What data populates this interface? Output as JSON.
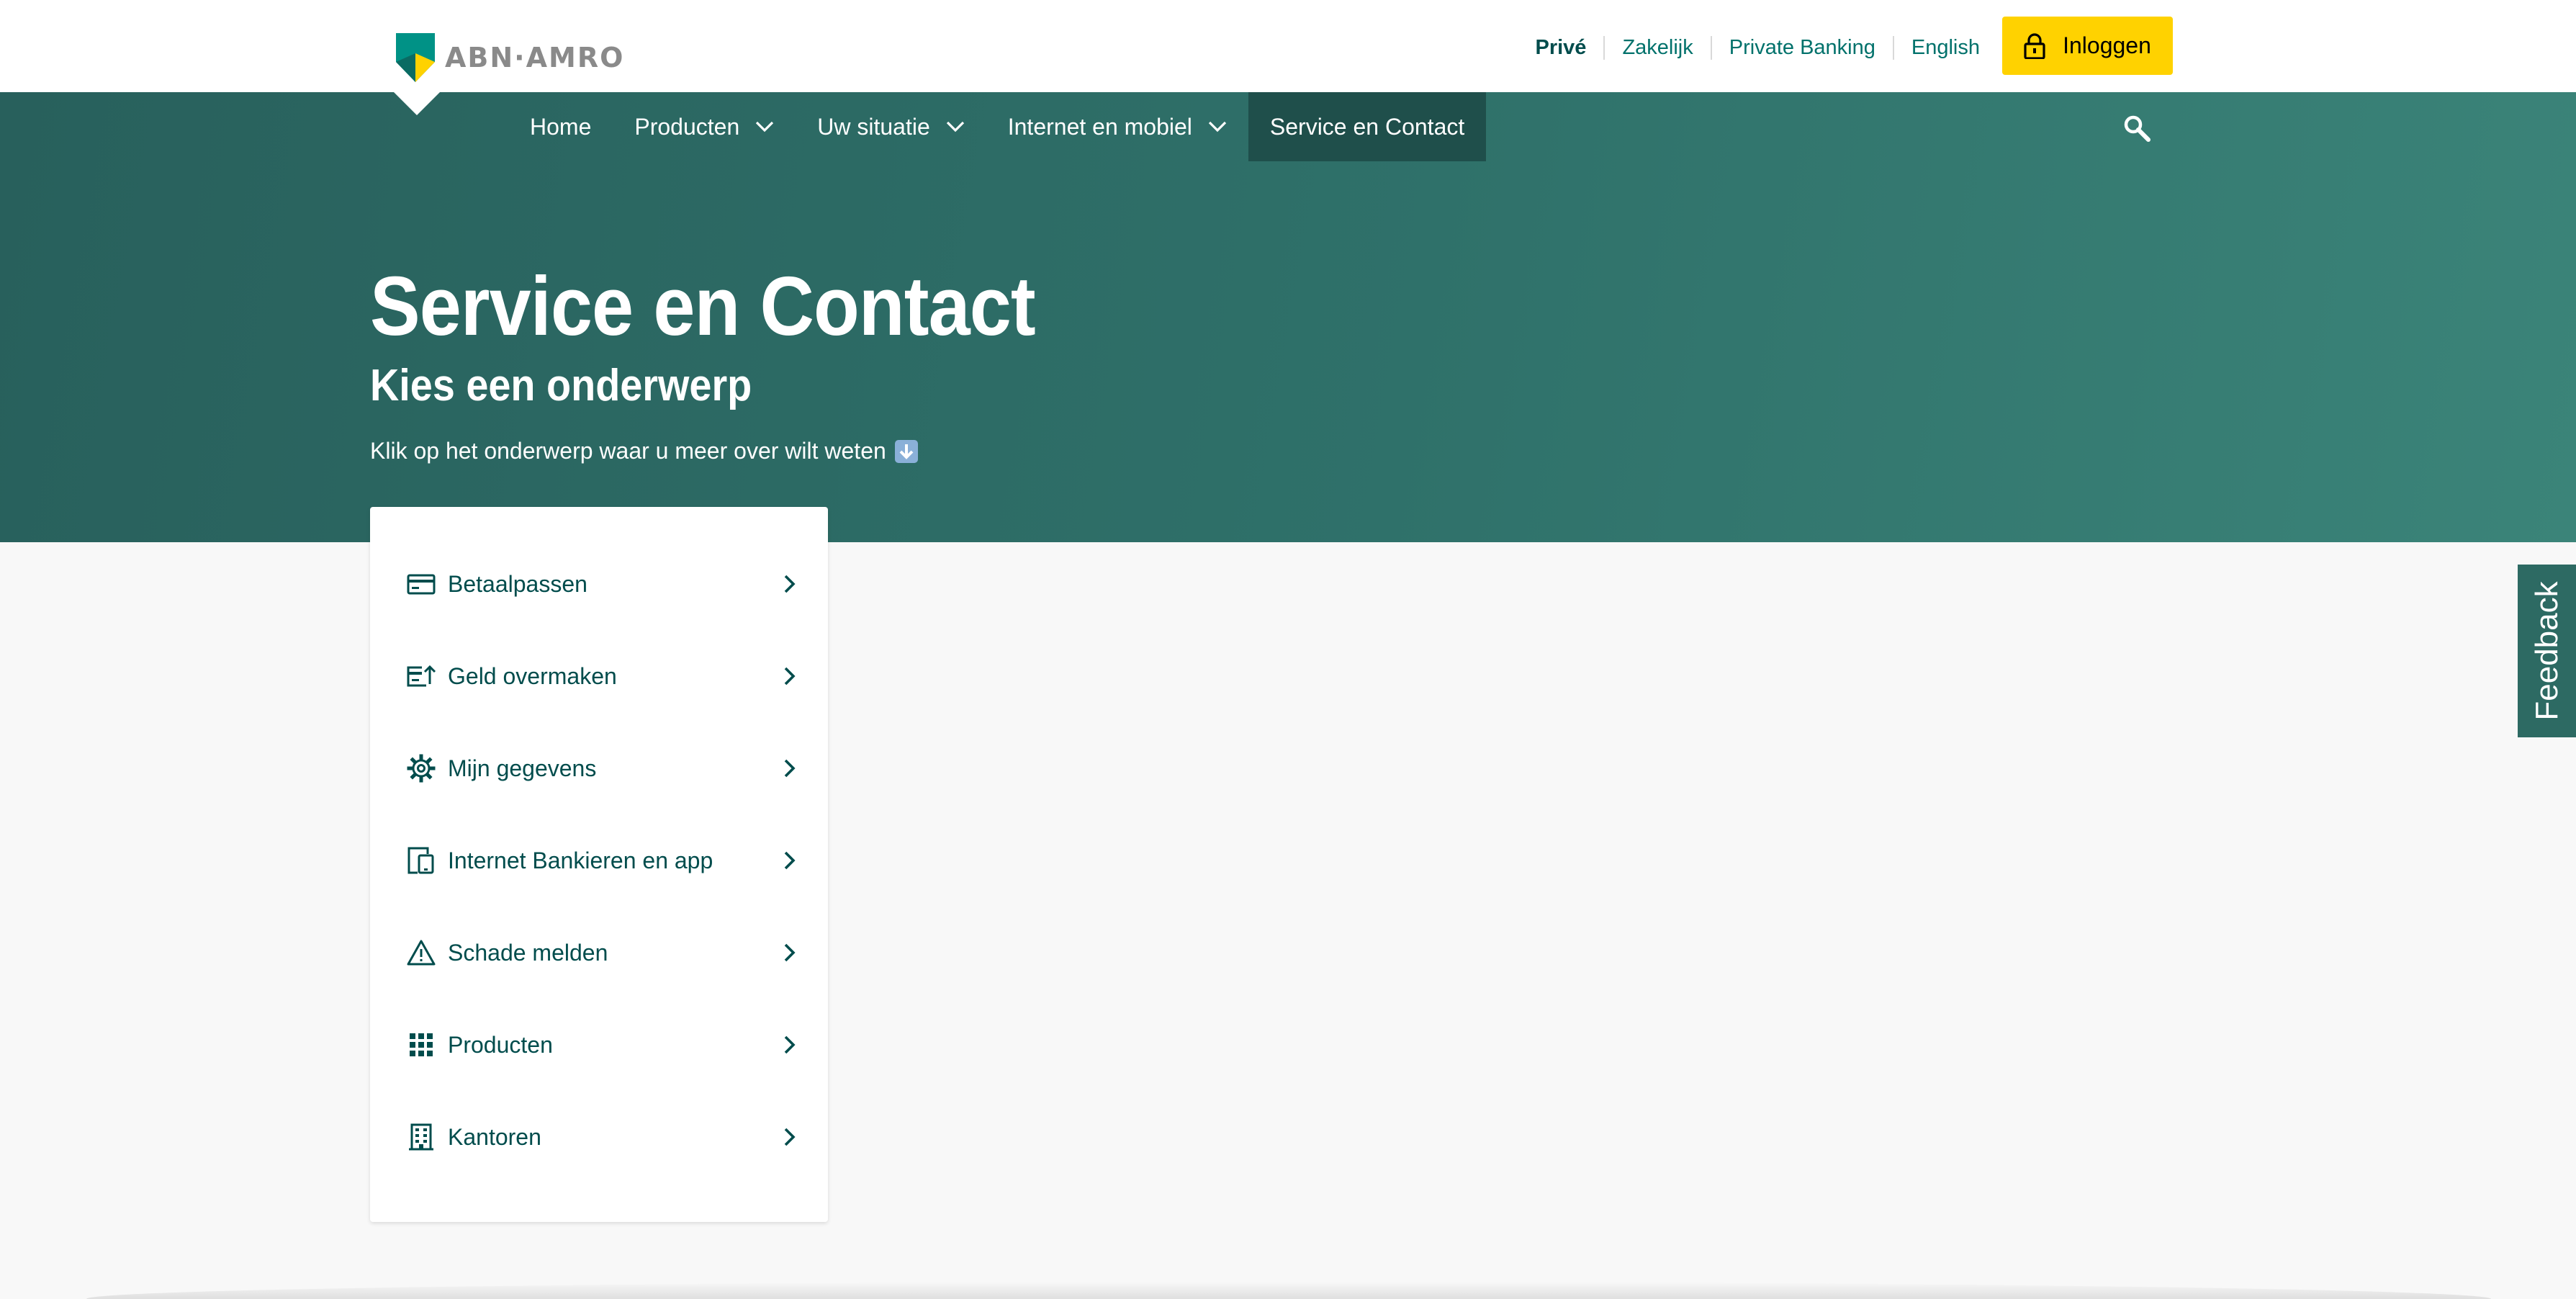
{
  "brand": {
    "logo_text": "ABN·AMRO",
    "colors": {
      "green": "#00716b",
      "dark_green": "#004c4c",
      "yellow": "#ffd200"
    }
  },
  "segments": [
    {
      "label": "Privé",
      "active": true
    },
    {
      "label": "Zakelijk"
    },
    {
      "label": "Private Banking"
    },
    {
      "label": "English"
    }
  ],
  "login": {
    "label": "Inloggen",
    "icon": "lock-icon"
  },
  "nav": {
    "items": [
      {
        "label": "Home"
      },
      {
        "label": "Producten",
        "icon": "chevron-down-icon"
      },
      {
        "label": "Uw situatie",
        "icon": "chevron-down-icon"
      },
      {
        "label": "Internet en mobiel",
        "icon": "chevron-down-icon"
      },
      {
        "label": "Service en Contact",
        "active": true
      }
    ],
    "search_icon": "search-icon"
  },
  "hero": {
    "title": "Service en Contact",
    "subtitle": "Kies een onderwerp",
    "intro": "Klik op het onderwerp waar u meer over wilt weten",
    "intro_emoji": "down-arrow-emoji"
  },
  "topics": [
    {
      "label": "Betaalpassen",
      "icon": "credit-card-icon"
    },
    {
      "label": "Geld overmaken",
      "icon": "transfer-icon"
    },
    {
      "label": "Mijn gegevens",
      "icon": "gear-icon"
    },
    {
      "label": "Internet Bankieren en app",
      "icon": "devices-icon"
    },
    {
      "label": "Schade melden",
      "icon": "warning-icon"
    },
    {
      "label": "Producten",
      "icon": "grid-icon"
    },
    {
      "label": "Kantoren",
      "icon": "building-icon"
    }
  ],
  "feedback": {
    "label": "Feedback"
  }
}
